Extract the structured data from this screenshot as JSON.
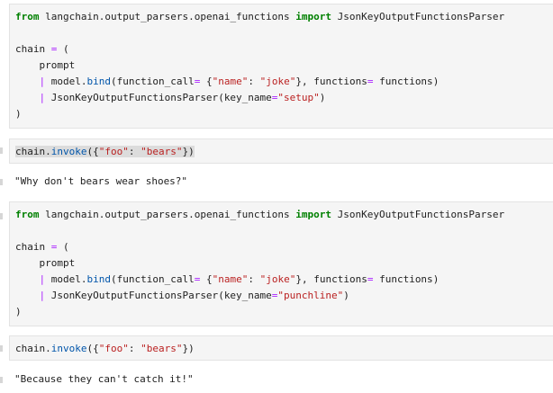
{
  "cells": [
    {
      "type": "code",
      "lines": [
        "from langchain.output_parsers.openai_functions import JsonKeyOutputFunctionsParser",
        "",
        "chain = (",
        "    prompt",
        "    | model.bind(function_call= {\"name\": \"joke\"}, functions= functions)",
        "    | JsonKeyOutputFunctionsParser(key_name=\"setup\")",
        ")"
      ]
    },
    {
      "type": "code",
      "lines": [
        "chain.invoke({\"foo\": \"bears\"})"
      ]
    },
    {
      "type": "output",
      "text": "\"Why don't bears wear shoes?\""
    },
    {
      "type": "code",
      "lines": [
        "from langchain.output_parsers.openai_functions import JsonKeyOutputFunctionsParser",
        "",
        "chain = (",
        "    prompt",
        "    | model.bind(function_call= {\"name\": \"joke\"}, functions= functions)",
        "    | JsonKeyOutputFunctionsParser(key_name=\"punchline\")",
        ")"
      ]
    },
    {
      "type": "code",
      "lines": [
        "chain.invoke({\"foo\": \"bears\"})"
      ]
    },
    {
      "type": "output",
      "text": "\"Because they can't catch it!\""
    }
  ],
  "colors": {
    "keyword": "#008000",
    "operator": "#aa22ff",
    "string": "#ba2121",
    "function": "#0055aa",
    "cell_bg": "#f5f5f5"
  }
}
